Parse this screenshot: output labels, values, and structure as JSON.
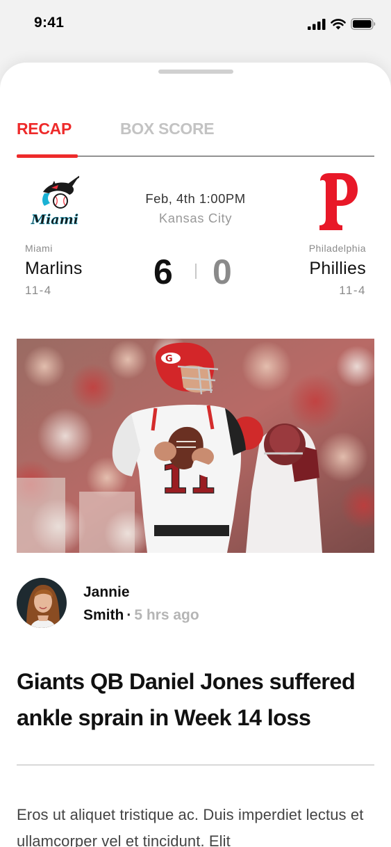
{
  "status_bar": {
    "time": "9:41"
  },
  "tabs": [
    {
      "label": "RECAP",
      "active": true
    },
    {
      "label": "BOX SCORE",
      "active": false
    }
  ],
  "game": {
    "date": "Feb, 4th 1:00PM",
    "venue": "Kansas City",
    "home": {
      "city": "Miami",
      "team": "Marlins",
      "record": "11-4",
      "score": "6",
      "logo": "marlins-logo",
      "logo_text": "Miami"
    },
    "away": {
      "city": "Philadelphia",
      "team": "Phillies",
      "record": "11-4",
      "score": "0",
      "logo": "phillies-logo"
    }
  },
  "article": {
    "image": "football-quarterback-photo",
    "author_first": "Jannie",
    "author_last": "Smith",
    "separator": "·",
    "time_ago": "5 hrs ago",
    "headline": "Giants QB Daniel Jones suffered ankle sprain in Week 14 loss",
    "body": "Eros ut aliquet tristique ac. Duis imperdiet lectus et ullamcorper vel et tincidunt. Elit"
  },
  "colors": {
    "accent": "#EE2B2B",
    "inactive_tab": "#C3C3C3",
    "muted": "#8A8A8A"
  }
}
